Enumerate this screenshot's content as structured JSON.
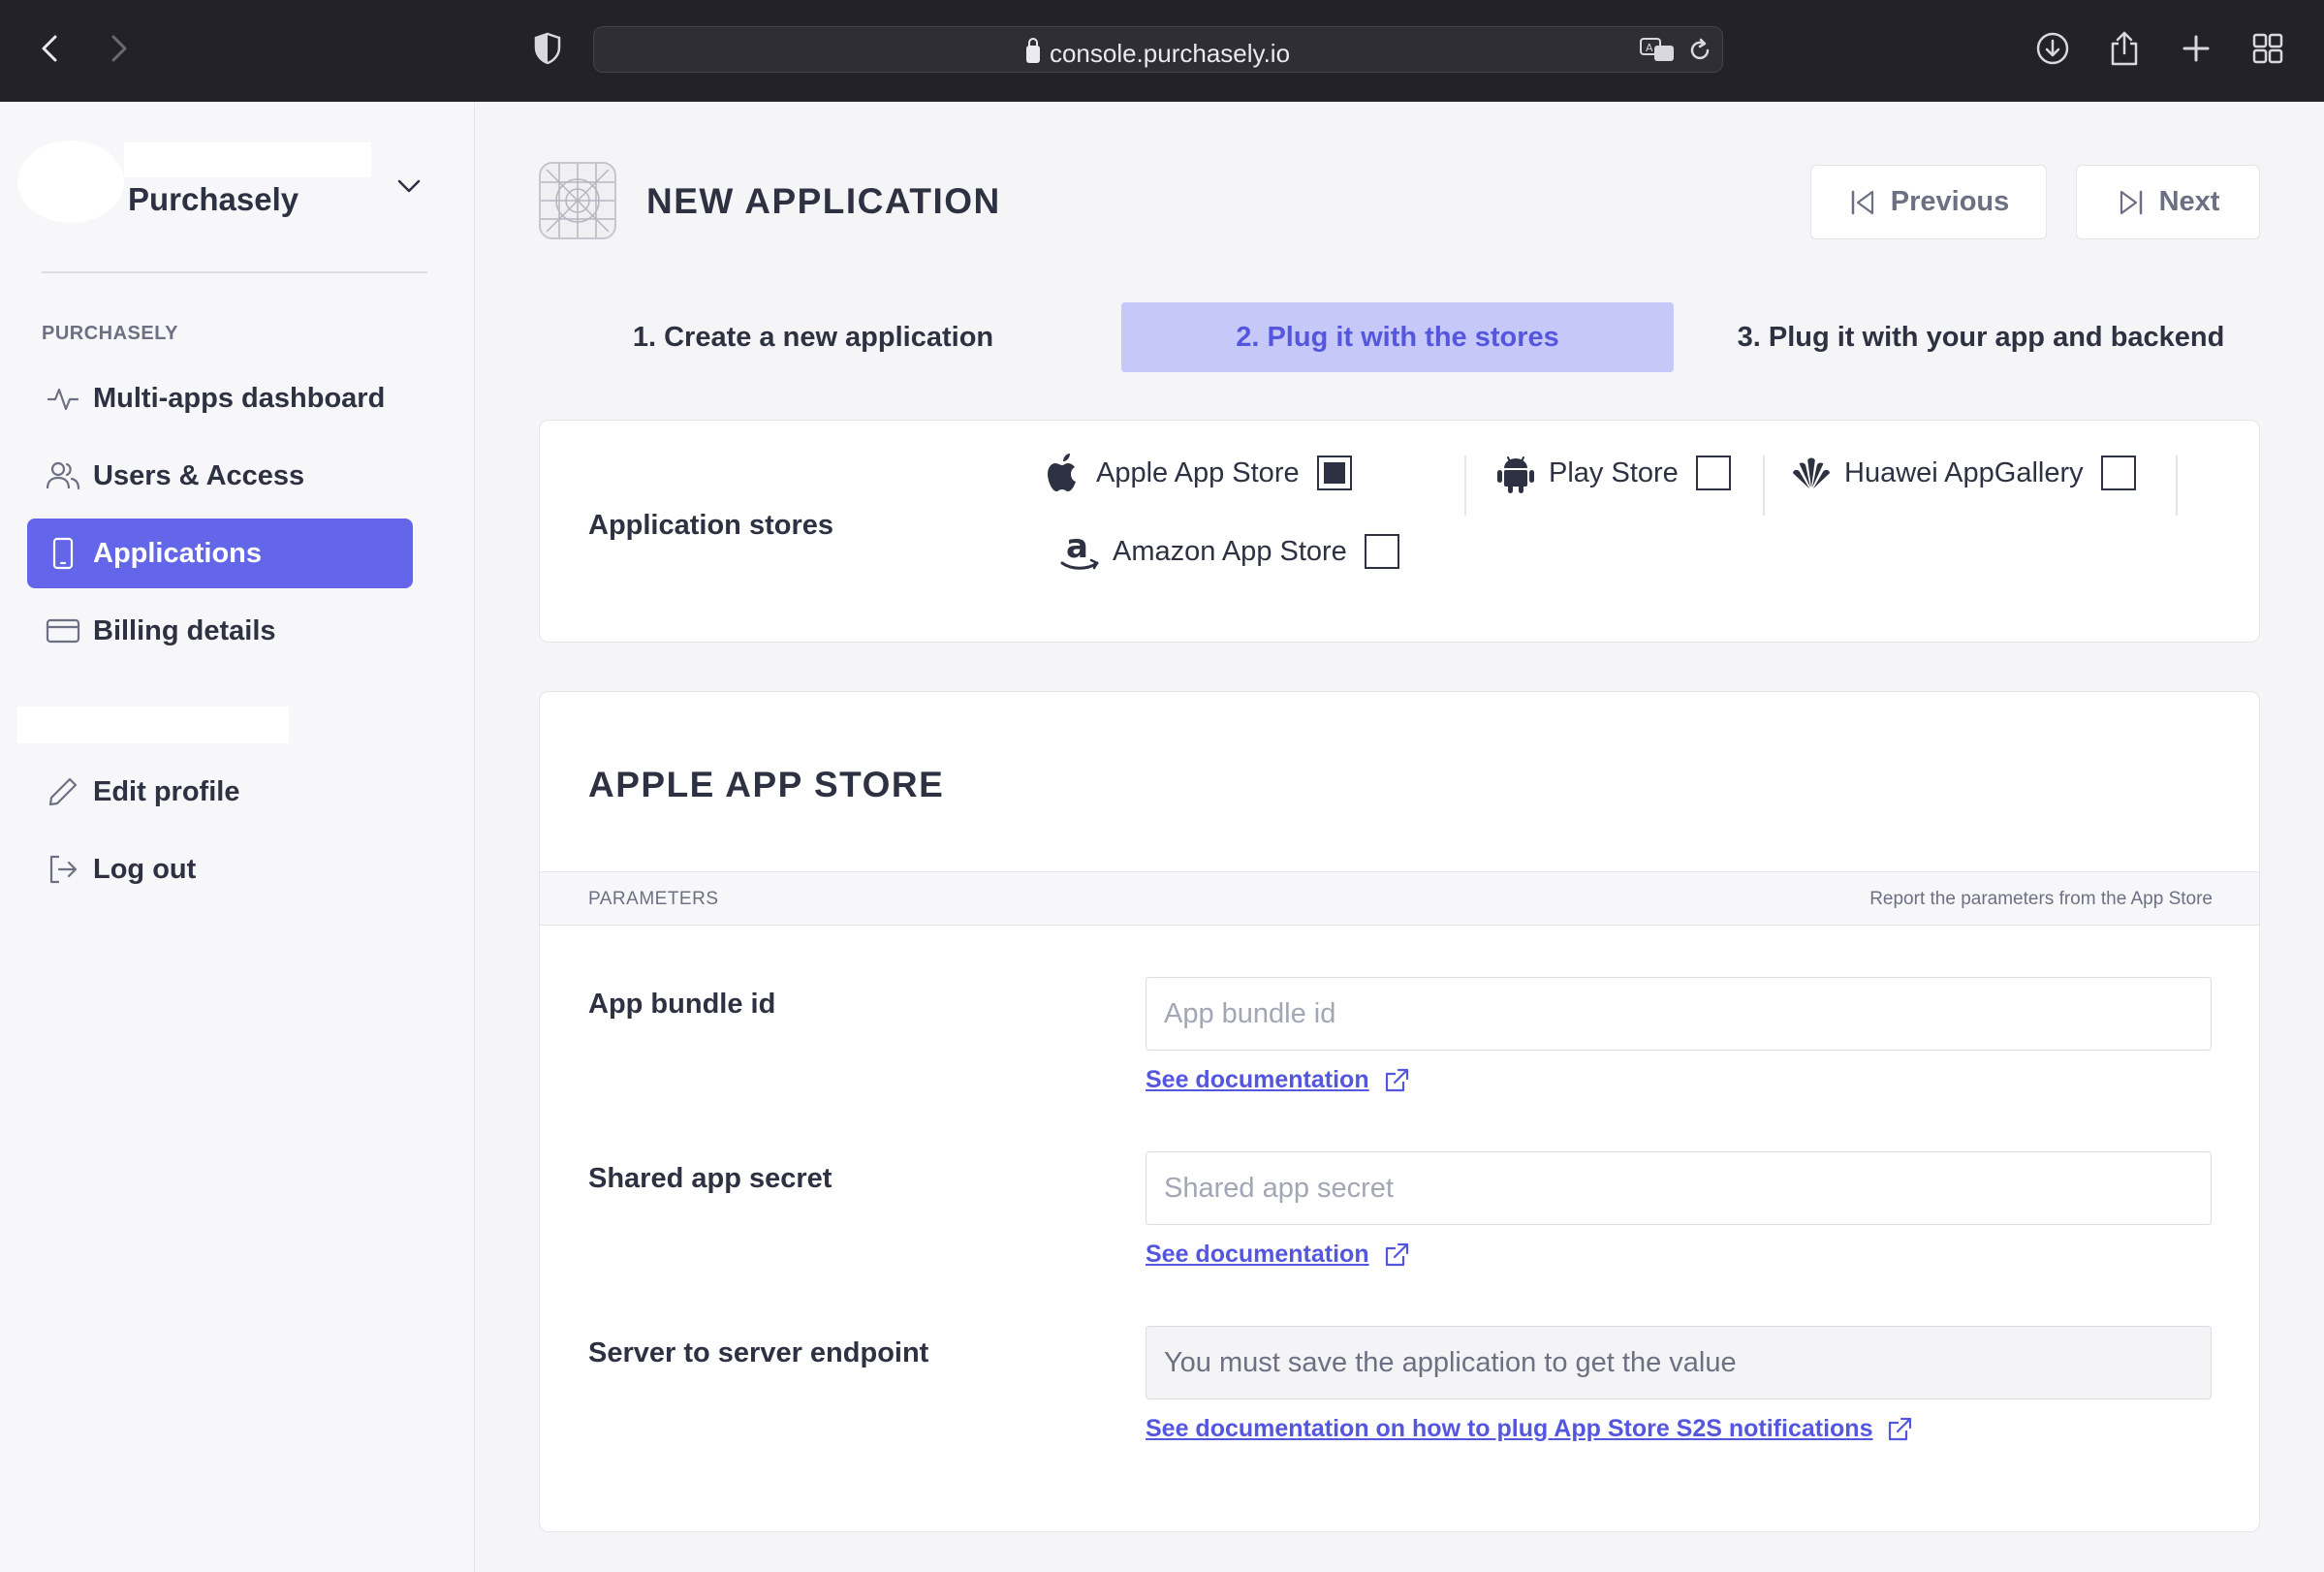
{
  "browser": {
    "url": "console.purchasely.io"
  },
  "sidebar": {
    "account_name": "Purchasely",
    "section_label": "PURCHASELY",
    "items": [
      {
        "label": "Multi-apps dashboard",
        "icon": "activity-icon"
      },
      {
        "label": "Users & Access",
        "icon": "users-icon"
      },
      {
        "label": "Applications",
        "icon": "smartphone-icon",
        "active": true
      },
      {
        "label": "Billing details",
        "icon": "credit-card-icon"
      }
    ],
    "profile_items": [
      {
        "label": "Edit profile",
        "icon": "pencil-icon"
      },
      {
        "label": "Log out",
        "icon": "logout-icon"
      }
    ]
  },
  "header": {
    "title": "NEW APPLICATION",
    "previous_label": "Previous",
    "next_label": "Next"
  },
  "steps": [
    {
      "label": "1. Create a new application",
      "active": false
    },
    {
      "label": "2. Plug it with the stores",
      "active": true
    },
    {
      "label": "3. Plug it with your app and backend",
      "active": false
    }
  ],
  "stores": {
    "label": "Application stores",
    "options": [
      {
        "name": "Apple App Store",
        "icon": "apple-icon",
        "checked": true
      },
      {
        "name": "Play Store",
        "icon": "android-icon",
        "checked": false
      },
      {
        "name": "Huawei AppGallery",
        "icon": "huawei-icon",
        "checked": false
      },
      {
        "name": "Amazon App Store",
        "icon": "amazon-icon",
        "checked": false
      }
    ]
  },
  "apple_section": {
    "title": "APPLE APP STORE",
    "parameters_label": "PARAMETERS",
    "parameters_hint": "Report the parameters from the App Store",
    "fields": [
      {
        "label": "App bundle id",
        "placeholder": "App bundle id",
        "link": "See documentation"
      },
      {
        "label": "Shared app secret",
        "placeholder": "Shared app secret",
        "link": "See documentation"
      },
      {
        "label": "Server to server endpoint",
        "placeholder": "You must save the application to get the value",
        "link": "See documentation on how to plug App Store S2S notifications"
      }
    ]
  },
  "colors": {
    "accent": "#6366e8",
    "step_active_bg": "#c7c8fa",
    "link": "#5457de",
    "chrome": "#23222a"
  }
}
